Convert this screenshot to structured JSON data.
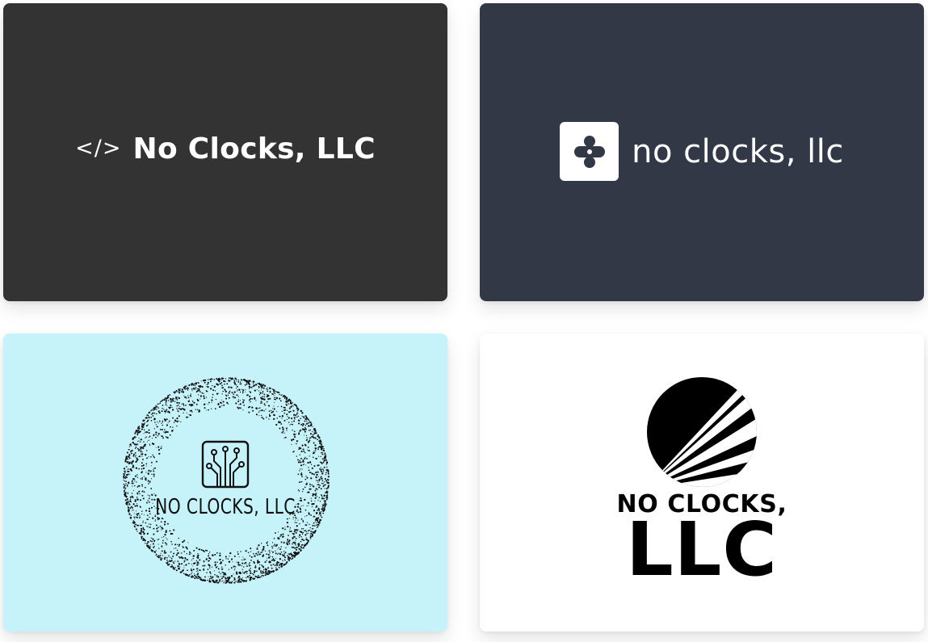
{
  "cards": [
    {
      "id": "card-1",
      "style": "dark-code",
      "background": "#333333",
      "icon": "code-brackets-icon",
      "icon_text": "</>",
      "name": "No Clocks, LLC"
    },
    {
      "id": "card-2",
      "style": "slate-app-icon",
      "background": "#323845",
      "icon": "dots-app-icon",
      "name": "no clocks, llc"
    },
    {
      "id": "card-3",
      "style": "stipple-seal",
      "background": "#c6f2fa",
      "icon": "circuit-board-icon",
      "name": "NO CLOCKS, LLC"
    },
    {
      "id": "card-4",
      "style": "sunburst",
      "background": "#ffffff",
      "icon": "sunburst-icon",
      "name_line1": "NO CLOCKS,",
      "name_line2": "LLC"
    }
  ]
}
